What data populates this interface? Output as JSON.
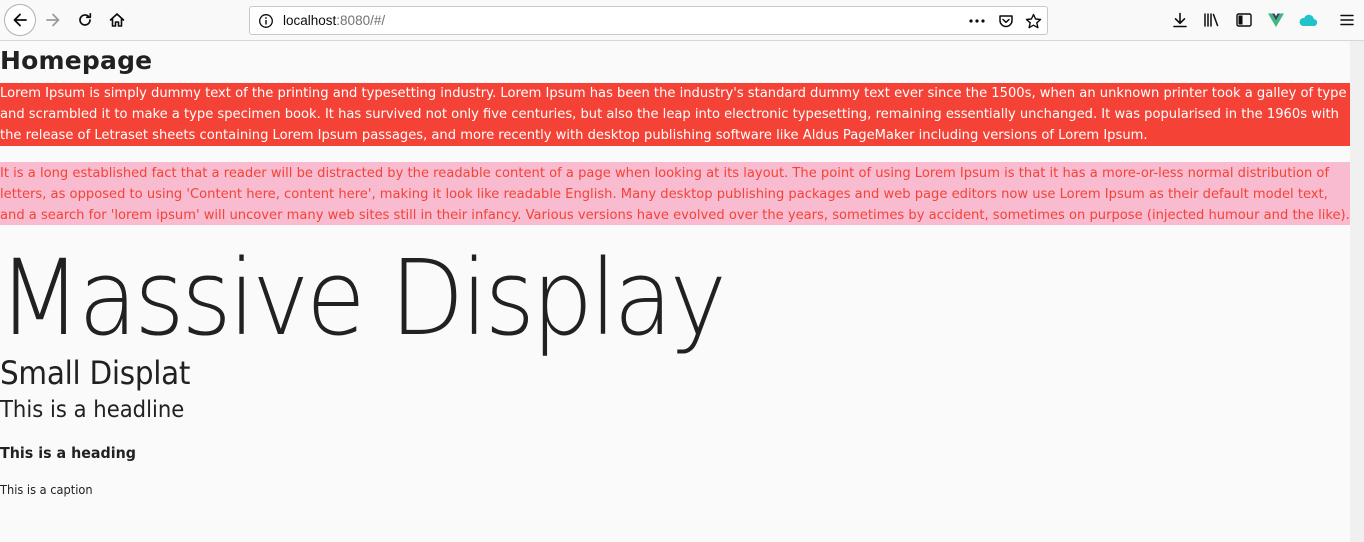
{
  "browser": {
    "url_host": "localhost",
    "url_rest": ":8080/#/",
    "icons": {
      "back": "back-arrow-icon",
      "forward": "forward-arrow-icon",
      "reload": "reload-icon",
      "home": "home-icon",
      "info": "info-icon",
      "more": "more-actions-icon",
      "pocket": "pocket-icon",
      "bookmark": "star-icon",
      "downloads": "download-icon",
      "library": "library-icon",
      "sidebar": "sidebar-icon",
      "vue": "vue-devtools-icon",
      "cloud": "cloud-icon",
      "menu": "hamburger-menu-icon"
    }
  },
  "page": {
    "title": "Homepage",
    "paragraph1": "Lorem Ipsum is simply dummy text of the printing and typesetting industry. Lorem Ipsum has been the industry's standard dummy text ever since the 1500s, when an unknown printer took a galley of type and scrambled it to make a type specimen book. It has survived not only five centuries, but also the leap into electronic typesetting, remaining essentially unchanged. It was popularised in the 1960s with the release of Letraset sheets containing Lorem Ipsum passages, and more recently with desktop publishing software like Aldus PageMaker including versions of Lorem Ipsum.",
    "paragraph2": "It is a long established fact that a reader will be distracted by the readable content of a page when looking at its layout. The point of using Lorem Ipsum is that it has a more-or-less normal distribution of letters, as opposed to using 'Content here, content here', making it look like readable English. Many desktop publishing packages and web page editors now use Lorem Ipsum as their default model text, and a search for 'lorem ipsum' will uncover many web sites still in their infancy. Various versions have evolved over the years, sometimes by accident, sometimes on purpose (injected humour and the like).",
    "display_large": "Massive Display",
    "display_small": "Small Displat",
    "headline": "This is a headline",
    "heading": "This is a heading",
    "caption": "This is a caption"
  },
  "colors": {
    "red_block_bg": "#f44336",
    "red_block_text": "#ffffff",
    "pink_block_bg": "#f8bbd0",
    "pink_block_text": "#f44336",
    "vue_green": "#41b883",
    "cloud_teal": "#1fc3c9"
  }
}
